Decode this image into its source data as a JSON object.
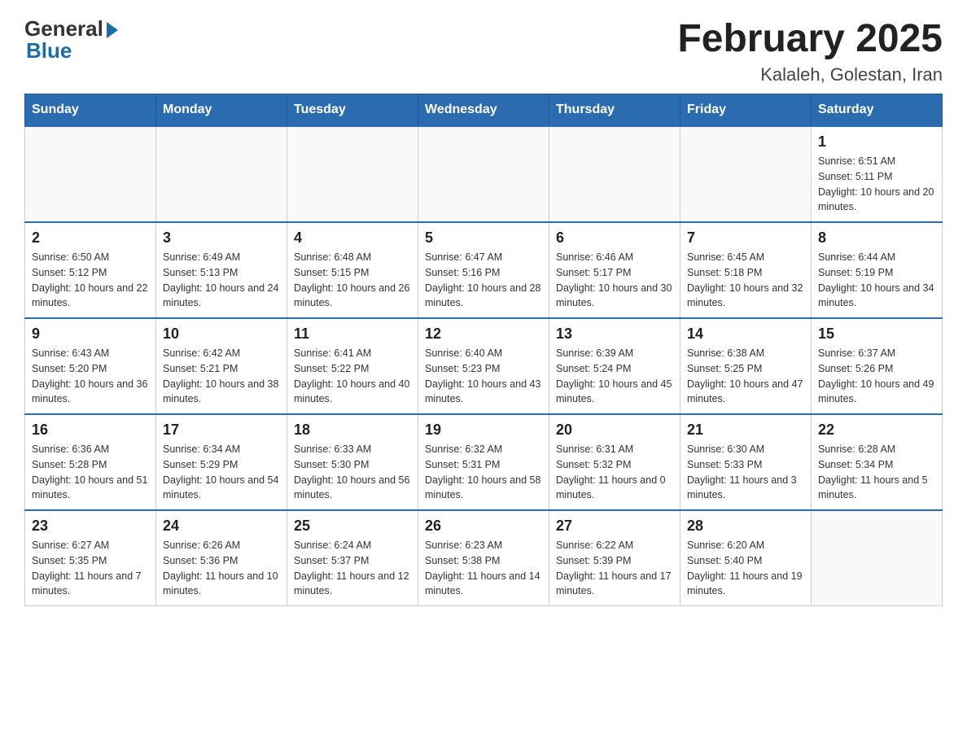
{
  "header": {
    "logo": {
      "general": "General",
      "blue": "Blue"
    },
    "title": "February 2025",
    "subtitle": "Kalaleh, Golestan, Iran"
  },
  "days_of_week": [
    "Sunday",
    "Monday",
    "Tuesday",
    "Wednesday",
    "Thursday",
    "Friday",
    "Saturday"
  ],
  "weeks": [
    [
      {
        "day": "",
        "sunrise": "",
        "sunset": "",
        "daylight": ""
      },
      {
        "day": "",
        "sunrise": "",
        "sunset": "",
        "daylight": ""
      },
      {
        "day": "",
        "sunrise": "",
        "sunset": "",
        "daylight": ""
      },
      {
        "day": "",
        "sunrise": "",
        "sunset": "",
        "daylight": ""
      },
      {
        "day": "",
        "sunrise": "",
        "sunset": "",
        "daylight": ""
      },
      {
        "day": "",
        "sunrise": "",
        "sunset": "",
        "daylight": ""
      },
      {
        "day": "1",
        "sunrise": "Sunrise: 6:51 AM",
        "sunset": "Sunset: 5:11 PM",
        "daylight": "Daylight: 10 hours and 20 minutes."
      }
    ],
    [
      {
        "day": "2",
        "sunrise": "Sunrise: 6:50 AM",
        "sunset": "Sunset: 5:12 PM",
        "daylight": "Daylight: 10 hours and 22 minutes."
      },
      {
        "day": "3",
        "sunrise": "Sunrise: 6:49 AM",
        "sunset": "Sunset: 5:13 PM",
        "daylight": "Daylight: 10 hours and 24 minutes."
      },
      {
        "day": "4",
        "sunrise": "Sunrise: 6:48 AM",
        "sunset": "Sunset: 5:15 PM",
        "daylight": "Daylight: 10 hours and 26 minutes."
      },
      {
        "day": "5",
        "sunrise": "Sunrise: 6:47 AM",
        "sunset": "Sunset: 5:16 PM",
        "daylight": "Daylight: 10 hours and 28 minutes."
      },
      {
        "day": "6",
        "sunrise": "Sunrise: 6:46 AM",
        "sunset": "Sunset: 5:17 PM",
        "daylight": "Daylight: 10 hours and 30 minutes."
      },
      {
        "day": "7",
        "sunrise": "Sunrise: 6:45 AM",
        "sunset": "Sunset: 5:18 PM",
        "daylight": "Daylight: 10 hours and 32 minutes."
      },
      {
        "day": "8",
        "sunrise": "Sunrise: 6:44 AM",
        "sunset": "Sunset: 5:19 PM",
        "daylight": "Daylight: 10 hours and 34 minutes."
      }
    ],
    [
      {
        "day": "9",
        "sunrise": "Sunrise: 6:43 AM",
        "sunset": "Sunset: 5:20 PM",
        "daylight": "Daylight: 10 hours and 36 minutes."
      },
      {
        "day": "10",
        "sunrise": "Sunrise: 6:42 AM",
        "sunset": "Sunset: 5:21 PM",
        "daylight": "Daylight: 10 hours and 38 minutes."
      },
      {
        "day": "11",
        "sunrise": "Sunrise: 6:41 AM",
        "sunset": "Sunset: 5:22 PM",
        "daylight": "Daylight: 10 hours and 40 minutes."
      },
      {
        "day": "12",
        "sunrise": "Sunrise: 6:40 AM",
        "sunset": "Sunset: 5:23 PM",
        "daylight": "Daylight: 10 hours and 43 minutes."
      },
      {
        "day": "13",
        "sunrise": "Sunrise: 6:39 AM",
        "sunset": "Sunset: 5:24 PM",
        "daylight": "Daylight: 10 hours and 45 minutes."
      },
      {
        "day": "14",
        "sunrise": "Sunrise: 6:38 AM",
        "sunset": "Sunset: 5:25 PM",
        "daylight": "Daylight: 10 hours and 47 minutes."
      },
      {
        "day": "15",
        "sunrise": "Sunrise: 6:37 AM",
        "sunset": "Sunset: 5:26 PM",
        "daylight": "Daylight: 10 hours and 49 minutes."
      }
    ],
    [
      {
        "day": "16",
        "sunrise": "Sunrise: 6:36 AM",
        "sunset": "Sunset: 5:28 PM",
        "daylight": "Daylight: 10 hours and 51 minutes."
      },
      {
        "day": "17",
        "sunrise": "Sunrise: 6:34 AM",
        "sunset": "Sunset: 5:29 PM",
        "daylight": "Daylight: 10 hours and 54 minutes."
      },
      {
        "day": "18",
        "sunrise": "Sunrise: 6:33 AM",
        "sunset": "Sunset: 5:30 PM",
        "daylight": "Daylight: 10 hours and 56 minutes."
      },
      {
        "day": "19",
        "sunrise": "Sunrise: 6:32 AM",
        "sunset": "Sunset: 5:31 PM",
        "daylight": "Daylight: 10 hours and 58 minutes."
      },
      {
        "day": "20",
        "sunrise": "Sunrise: 6:31 AM",
        "sunset": "Sunset: 5:32 PM",
        "daylight": "Daylight: 11 hours and 0 minutes."
      },
      {
        "day": "21",
        "sunrise": "Sunrise: 6:30 AM",
        "sunset": "Sunset: 5:33 PM",
        "daylight": "Daylight: 11 hours and 3 minutes."
      },
      {
        "day": "22",
        "sunrise": "Sunrise: 6:28 AM",
        "sunset": "Sunset: 5:34 PM",
        "daylight": "Daylight: 11 hours and 5 minutes."
      }
    ],
    [
      {
        "day": "23",
        "sunrise": "Sunrise: 6:27 AM",
        "sunset": "Sunset: 5:35 PM",
        "daylight": "Daylight: 11 hours and 7 minutes."
      },
      {
        "day": "24",
        "sunrise": "Sunrise: 6:26 AM",
        "sunset": "Sunset: 5:36 PM",
        "daylight": "Daylight: 11 hours and 10 minutes."
      },
      {
        "day": "25",
        "sunrise": "Sunrise: 6:24 AM",
        "sunset": "Sunset: 5:37 PM",
        "daylight": "Daylight: 11 hours and 12 minutes."
      },
      {
        "day": "26",
        "sunrise": "Sunrise: 6:23 AM",
        "sunset": "Sunset: 5:38 PM",
        "daylight": "Daylight: 11 hours and 14 minutes."
      },
      {
        "day": "27",
        "sunrise": "Sunrise: 6:22 AM",
        "sunset": "Sunset: 5:39 PM",
        "daylight": "Daylight: 11 hours and 17 minutes."
      },
      {
        "day": "28",
        "sunrise": "Sunrise: 6:20 AM",
        "sunset": "Sunset: 5:40 PM",
        "daylight": "Daylight: 11 hours and 19 minutes."
      },
      {
        "day": "",
        "sunrise": "",
        "sunset": "",
        "daylight": ""
      }
    ]
  ]
}
